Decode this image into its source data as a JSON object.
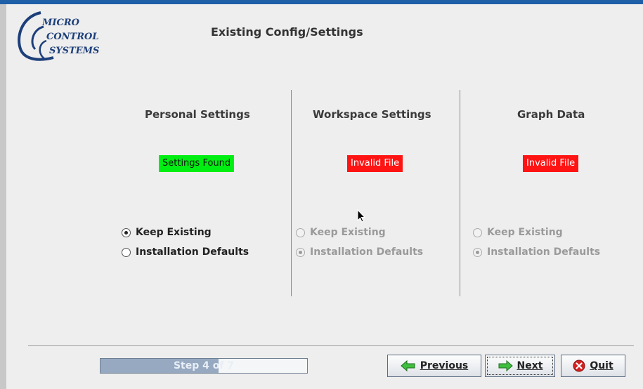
{
  "header": {
    "logo": {
      "line1": "MICRO",
      "line2": "CONTROL",
      "line3": "SYSTEMS"
    },
    "title": "Existing Config/Settings"
  },
  "columns": [
    {
      "title": "Personal Settings",
      "status": "Settings Found",
      "status_color": "#00ee11",
      "options": [
        "Keep Existing",
        "Installation Defaults"
      ],
      "selected": "Keep Existing",
      "enabled": true
    },
    {
      "title": "Workspace Settings",
      "status": "Invalid File",
      "status_color": "#ff1414",
      "options": [
        "Keep Existing",
        "Installation Defaults"
      ],
      "selected": "Installation Defaults",
      "enabled": false
    },
    {
      "title": "Graph Data",
      "status": "Invalid File",
      "status_color": "#ff1414",
      "options": [
        "Keep Existing",
        "Installation Defaults"
      ],
      "selected": "Installation Defaults",
      "enabled": false
    }
  ],
  "footer": {
    "progress": {
      "text": "Step 4 of 7",
      "current": 4,
      "total": 7
    },
    "buttons": {
      "previous": "Previous",
      "next": "Next",
      "quit": "Quit"
    }
  },
  "colors": {
    "accent": "#1f5fa8",
    "found": "#00ee11",
    "invalid": "#ff1414"
  }
}
